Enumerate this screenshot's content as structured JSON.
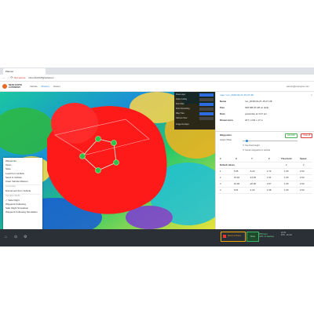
{
  "browser": {
    "tab_title": "Planner",
    "security_label": "Not secure",
    "url": "robot.3DAS/flightplanner",
    "nav_glyphs": "← → ⟳"
  },
  "app": {
    "brand_line1": "NEAR EARTH",
    "brand_line2": "AUTONOMY",
    "nav_items": [
      "Vehicle",
      "Planner",
      "Viewer"
    ],
    "active_nav": "Planner",
    "user": "admin@example.com"
  },
  "file_panel": {
    "title": "map / run_2018-03-27-15-07-38",
    "close": "×",
    "rows": [
      {
        "key": "Name",
        "value": "run_2018-03-27-15-07-38"
      },
      {
        "key": "Size",
        "value": "928 MB (8 GB on disk)"
      },
      {
        "key": "Date",
        "value": "yesterday at 3:27 pm"
      },
      {
        "key": "Dimensions",
        "value": "247 x 243 x 17 m"
      }
    ]
  },
  "waypoints_panel": {
    "title": "Waypoints",
    "btn_add": "Add Path",
    "btn_clear": "Clear all",
    "height_label": "Height Offset",
    "check1": "Use fixed height",
    "check2": "Center waypoints to vertical",
    "columns": [
      "#",
      "X",
      "Y",
      "Z",
      "Threshold",
      "Speed"
    ],
    "default_label": "Default values",
    "default_threshold": "2",
    "default_speed": "2",
    "rows": [
      [
        "1",
        "5.95",
        "-5.20",
        "2.74",
        "1.00",
        "2.00"
      ],
      [
        "2",
        "15.92",
        "-14.45",
        "1.51",
        "1.00",
        "2.00"
      ],
      [
        "3",
        "19.90",
        "-26.00",
        "2.57",
        "1.00",
        "2.00"
      ],
      [
        "4",
        "9.61",
        "-1.62",
        "2.38",
        "1.00",
        "2.00"
      ]
    ]
  },
  "layers_panel": {
    "rows": [
      "Draw Layer",
      "Color Coding",
      "Point Size",
      "Point Smoothing",
      "Filter Tiles",
      "Camera View",
      "Image Overlays"
    ]
  },
  "context_menu": {
    "title": "Waypoints",
    "items_a": [
      "Open...",
      "Save",
      "Load from Vehicle",
      "Send to Vehicle",
      "Clear Vehicle Mission"
    ],
    "section_b": "Connection",
    "items_b": [
      "Disconnect from Vehicle"
    ],
    "section_c": "Operation Mode",
    "items_c": [
      "Safe Flight",
      "Waypoint Following",
      "Safe Flight Simulation",
      "Waypoint Following Simulation"
    ],
    "selected": "Safe Flight"
  },
  "status_bar": {
    "alarm_label": "Return to Home",
    "mode_label": "Hover",
    "connection": "RTK fixed",
    "connection_sub": "GPS: 21 satellites",
    "battery": "23.4V",
    "battery_sub": "87% · 16 min",
    "icons": [
      "home-icon",
      "pin-icon",
      "settings-icon"
    ]
  },
  "colors": {
    "accent": "#1e88e5",
    "map_red": "#ff1a1a",
    "waypoint": "#2ec44a"
  }
}
